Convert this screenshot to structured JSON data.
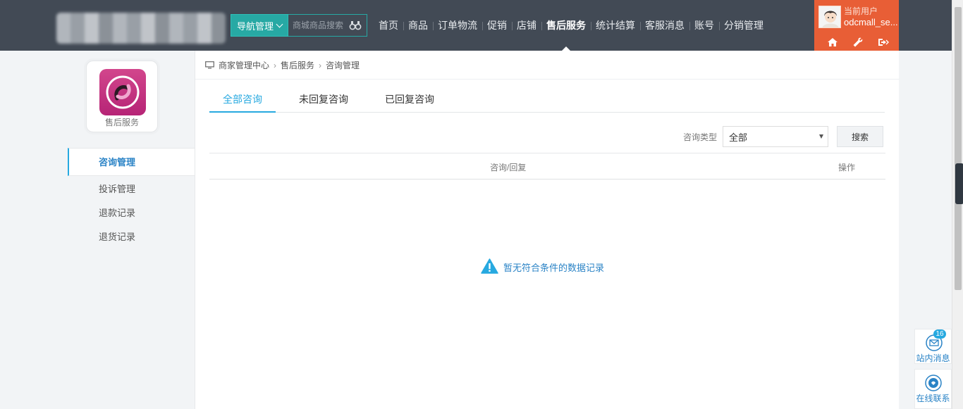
{
  "header": {
    "nav_manage_label": "导航管理",
    "search_placeholder": "商城商品搜索",
    "nav_items": [
      {
        "label": "首页"
      },
      {
        "label": "商品"
      },
      {
        "label": "订单物流"
      },
      {
        "label": "促销"
      },
      {
        "label": "店铺"
      },
      {
        "label": "售后服务",
        "active": true
      },
      {
        "label": "统计结算"
      },
      {
        "label": "客服消息"
      },
      {
        "label": "账号"
      },
      {
        "label": "分销管理"
      }
    ],
    "user": {
      "label": "当前用户",
      "name": "odcmall_se..."
    },
    "user_icons": [
      "home-icon",
      "wrench-icon",
      "logout-icon"
    ]
  },
  "sidebar": {
    "app_label": "售后服务",
    "menu": [
      {
        "label": "咨询管理",
        "active": true
      },
      {
        "label": "投诉管理"
      },
      {
        "label": "退款记录"
      },
      {
        "label": "退货记录"
      }
    ]
  },
  "breadcrumb": [
    "商家管理中心",
    "售后服务",
    "咨询管理"
  ],
  "tabs": [
    {
      "label": "全部咨询",
      "active": true
    },
    {
      "label": "未回复咨询"
    },
    {
      "label": "已回复咨询"
    }
  ],
  "filter": {
    "label": "咨询类型",
    "selected": "全部",
    "search_button": "搜索"
  },
  "table": {
    "columns": [
      "咨询/回复",
      "操作"
    ]
  },
  "empty_message": "暂无符合条件的数据记录",
  "float": {
    "messages_label": "站内消息",
    "messages_count": "16",
    "chat_label": "在线联系"
  },
  "colors": {
    "header_bg": "#424a55",
    "accent_teal": "#27a9a4",
    "accent_blue": "#27a9e0",
    "user_box": "#e85e36",
    "app_icon": "#c3327f"
  }
}
